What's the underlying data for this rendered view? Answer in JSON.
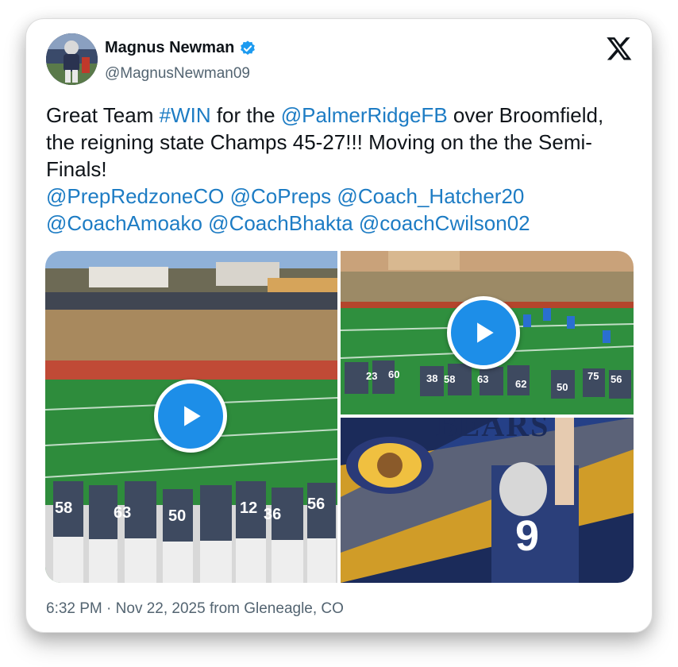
{
  "author": {
    "name": "Magnus Newman",
    "handle": "@MagnusNewman09",
    "verified_icon": "verified-badge-icon"
  },
  "brand_icon": "x-logo-icon",
  "tweet": {
    "t1": "Great Team ",
    "hashtag": "#WIN",
    "t2": " for the ",
    "mention_main": "@PalmerRidgeFB",
    "t3": " over Broomfield, the reigning state Champs 45-27!!! Moving on the the Semi-Finals!",
    "mentions": [
      "@PrepRedzoneCO",
      "@CoPreps",
      "@Coach_Hatcher20",
      "@CoachAmoako",
      "@CoachBhakta",
      "@coachCwilson02"
    ]
  },
  "media": {
    "tile1": {
      "type": "video",
      "players": [
        "58",
        "63",
        "50",
        "36",
        "12",
        "56"
      ]
    },
    "tile2": {
      "type": "video",
      "players": [
        "23",
        "60",
        "38",
        "58",
        "63",
        "62",
        "50",
        "75",
        "56"
      ]
    },
    "tile3": {
      "type": "image",
      "banner_text": "BEARS",
      "jersey": "9"
    }
  },
  "footer": {
    "time": "6:32 PM",
    "separator": " · ",
    "date": "Nov 22, 2025",
    "source": " from Gleneagle, CO"
  },
  "colors": {
    "link": "#1d7cc4",
    "play_button": "#1d8ee8",
    "verified": "#1d9bf0",
    "text": "#0f1419",
    "muted": "#536471"
  }
}
